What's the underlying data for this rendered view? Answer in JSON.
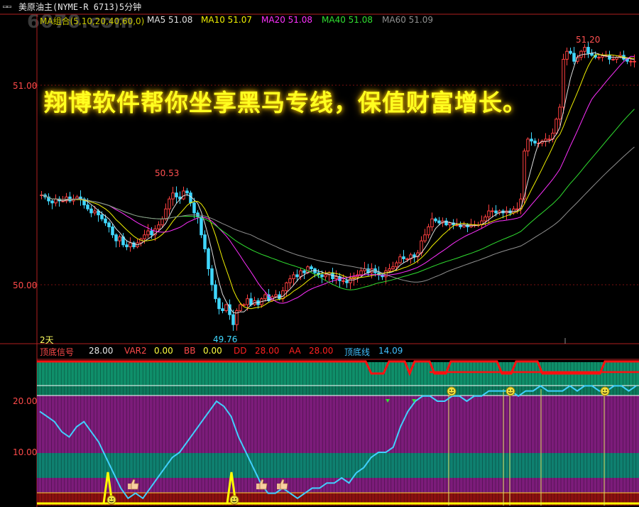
{
  "window": {
    "title": "美原油主(NYME-R 6713)5分钟",
    "watermark": "6070.com"
  },
  "ma_legend": [
    {
      "label": "MA组合(5,10,20,40,60,0)",
      "color": "#c8c800"
    },
    {
      "label": "MA5 51.08",
      "color": "#e0e0e0"
    },
    {
      "label": "MA10 51.07",
      "color": "#f0f000"
    },
    {
      "label": "MA20 51.08",
      "color": "#ff30ff"
    },
    {
      "label": "MA40 51.08",
      "color": "#30e030"
    },
    {
      "label": "MA60 51.09",
      "color": "#909090"
    }
  ],
  "banner": "翔博软件帮你坐享黑马专线，保值财富增长。",
  "period_label": "2天",
  "indicator_legend": [
    {
      "label": "顶底信号",
      "color": "#ff4a4a"
    },
    {
      "label": "28.00",
      "color": "#e8e8e8"
    },
    {
      "label": "VAR2",
      "color": "#ff4a4a"
    },
    {
      "label": "0.00",
      "color": "#ffff40"
    },
    {
      "label": "BB",
      "color": "#ff4a4a"
    },
    {
      "label": "0.00",
      "color": "#ffff40"
    },
    {
      "label": "DD",
      "color": "#ff2020"
    },
    {
      "label": "28.00",
      "color": "#ff2020"
    },
    {
      "label": "AA",
      "color": "#ff2020"
    },
    {
      "label": "28.00",
      "color": "#ff2020"
    },
    {
      "label": "顶底线",
      "color": "#40c0ff"
    },
    {
      "label": "14.09",
      "color": "#40c0ff"
    }
  ],
  "chart_data": [
    {
      "type": "candlestick",
      "title": "美原油主(NYME-R 6713)5分钟",
      "y_ticks": [
        "51.00",
        "50.00"
      ],
      "ylim": [
        49.7,
        51.3
      ],
      "annotations": [
        {
          "text": "50.53",
          "value": 50.53,
          "kind": "high"
        },
        {
          "text": "49.76",
          "value": 49.76,
          "kind": "low"
        },
        {
          "text": "51.20",
          "value": 51.2,
          "kind": "high"
        }
      ],
      "close": [
        50.45,
        50.44,
        50.42,
        50.41,
        50.43,
        50.42,
        50.42,
        50.44,
        50.42,
        50.43,
        50.44,
        50.43,
        50.4,
        50.38,
        50.36,
        50.37,
        50.35,
        50.33,
        50.31,
        50.29,
        50.25,
        50.22,
        50.24,
        50.2,
        50.19,
        50.21,
        50.19,
        50.21,
        50.23,
        50.25,
        50.27,
        50.25,
        50.28,
        50.3,
        50.33,
        50.38,
        50.43,
        50.46,
        50.44,
        50.43,
        50.47,
        50.46,
        50.41,
        50.36,
        50.34,
        50.25,
        50.18,
        50.08,
        50.0,
        49.93,
        49.88,
        49.87,
        49.9,
        49.85,
        49.8,
        49.87,
        49.9,
        49.9,
        49.93,
        49.9,
        49.92,
        49.9,
        49.93,
        49.95,
        49.92,
        49.94,
        49.95,
        49.93,
        49.97,
        50.01,
        50.03,
        50.05,
        50.04,
        50.07,
        50.06,
        50.09,
        50.08,
        50.06,
        50.05,
        50.04,
        50.05,
        50.06,
        50.03,
        50.04,
        50.02,
        50.02,
        50.01,
        50.03,
        50.04,
        50.05,
        50.07,
        50.08,
        50.06,
        50.08,
        50.06,
        50.05,
        50.04,
        50.07,
        50.08,
        50.09,
        50.11,
        50.14,
        50.13,
        50.13,
        50.15,
        50.14,
        50.16,
        50.22,
        50.25,
        50.29,
        50.33,
        50.32,
        50.31,
        50.32,
        50.3,
        50.31,
        50.3,
        50.3,
        50.29,
        50.3,
        50.29,
        50.3,
        50.3,
        50.3,
        50.32,
        50.34,
        50.37,
        50.37,
        50.36,
        50.37,
        50.36,
        50.37,
        50.36,
        50.38,
        50.38,
        50.43,
        50.67,
        50.73,
        50.72,
        50.71,
        50.71,
        50.72,
        50.73,
        50.73,
        50.76,
        50.83,
        50.89,
        51.13,
        51.17,
        51.16,
        51.12,
        51.14,
        51.17,
        51.19,
        51.16,
        51.15,
        51.14,
        51.14,
        51.15,
        51.15,
        51.13,
        51.13,
        51.14,
        51.15,
        51.13,
        51.12,
        51.12,
        51.12
      ]
    },
    {
      "type": "line",
      "title": "顶底信号",
      "y_ticks": [
        "20.00",
        "10.00"
      ],
      "ylim": [
        0,
        28
      ],
      "series": [
        {
          "name": "顶底线",
          "values": [
            18,
            17,
            16,
            14,
            13,
            15,
            16,
            14,
            12,
            9,
            6,
            3,
            1,
            2,
            1,
            3,
            5,
            7,
            9,
            10,
            12,
            14,
            16,
            18,
            20,
            19,
            17,
            13,
            10,
            7,
            4,
            2,
            2,
            3,
            2,
            1,
            2,
            3,
            3,
            4,
            4,
            5,
            4,
            6,
            7,
            9,
            10,
            10,
            11,
            15,
            18,
            20,
            21,
            21,
            20,
            20,
            21,
            21,
            20,
            21,
            21,
            22,
            22,
            22,
            22,
            21,
            22,
            22,
            23,
            22,
            22,
            22,
            23,
            22,
            23,
            23,
            22,
            22,
            23,
            23,
            22,
            23
          ]
        }
      ]
    }
  ]
}
